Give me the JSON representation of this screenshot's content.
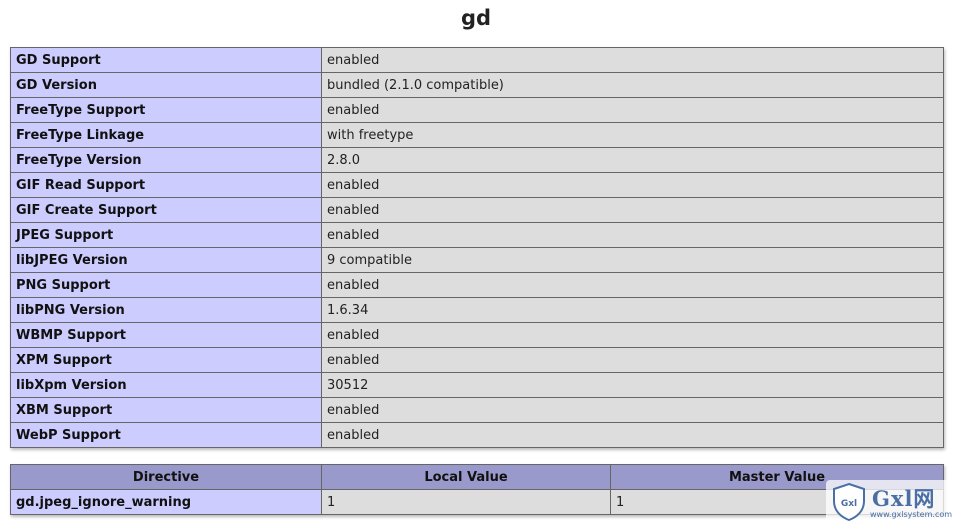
{
  "page": {
    "title": "gd"
  },
  "support_rows": [
    {
      "key": "GD Support",
      "value": "enabled"
    },
    {
      "key": "GD Version",
      "value": "bundled (2.1.0 compatible)"
    },
    {
      "key": "FreeType Support",
      "value": "enabled"
    },
    {
      "key": "FreeType Linkage",
      "value": "with freetype"
    },
    {
      "key": "FreeType Version",
      "value": "2.8.0"
    },
    {
      "key": "GIF Read Support",
      "value": "enabled"
    },
    {
      "key": "GIF Create Support",
      "value": "enabled"
    },
    {
      "key": "JPEG Support",
      "value": "enabled"
    },
    {
      "key": "libJPEG Version",
      "value": "9 compatible"
    },
    {
      "key": "PNG Support",
      "value": "enabled"
    },
    {
      "key": "libPNG Version",
      "value": "1.6.34"
    },
    {
      "key": "WBMP Support",
      "value": "enabled"
    },
    {
      "key": "XPM Support",
      "value": "enabled"
    },
    {
      "key": "libXpm Version",
      "value": "30512"
    },
    {
      "key": "XBM Support",
      "value": "enabled"
    },
    {
      "key": "WebP Support",
      "value": "enabled"
    }
  ],
  "directives": {
    "headers": {
      "directive": "Directive",
      "local": "Local Value",
      "master": "Master Value"
    },
    "rows": [
      {
        "directive": "gd.jpeg_ignore_warning",
        "local": "1",
        "master": "1"
      }
    ]
  },
  "watermark": {
    "brand": "Gxl网",
    "url": "www.gxlsystem.com",
    "shield_text": "Gxl"
  },
  "colors": {
    "key_cell": "#ccccff",
    "value_cell": "#dddddd",
    "header_cell": "#9999cc",
    "border": "#666666"
  }
}
